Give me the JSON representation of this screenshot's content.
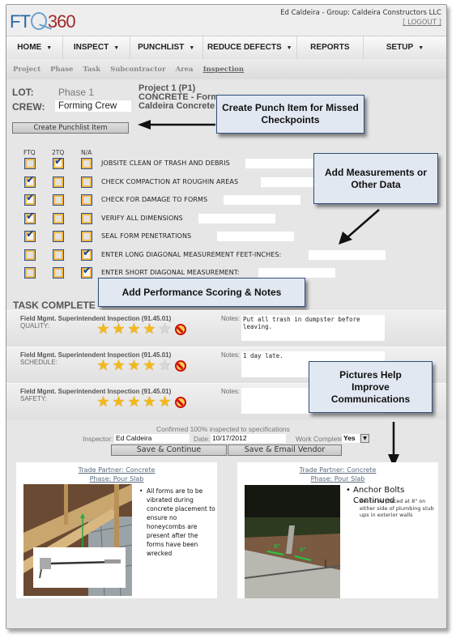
{
  "header": {
    "logo_left": "FT",
    "logo_right": "360",
    "user": "Ed Caldeira -  Group: Caldeira Constructors LLC",
    "logout": "[ LOGOUT ]"
  },
  "nav": {
    "items": [
      {
        "label": "HOME",
        "has_menu": true
      },
      {
        "label": "INSPECT",
        "has_menu": true
      },
      {
        "label": "PUNCHLIST",
        "has_menu": true
      },
      {
        "label": "REDUCE DEFECTS",
        "has_menu": true
      },
      {
        "label": "REPORTS",
        "has_menu": false
      },
      {
        "label": "SETUP",
        "has_menu": true
      }
    ]
  },
  "subnav": {
    "items": [
      "Project",
      "Phase",
      "Task",
      "Subcontractor",
      "Area",
      "Inspection"
    ],
    "active": "Inspection"
  },
  "info": {
    "lot_label": "LOT:",
    "lot_value": "Phase 1",
    "crew_label": "CREW:",
    "crew_value": "Forming Crew",
    "project_line1": "Project 1 (P1)",
    "project_line2": "CONCRETE - Forming",
    "project_line3": "Caldeira Concrete"
  },
  "create_punchlist_button": "Create Punchlist Item",
  "callouts": {
    "punch": "Create Punch Item for Missed Checkpoints",
    "measurements": "Add Measurements or Other Data",
    "scoring": "Add Performance Scoring & Notes",
    "pictures": "Pictures Help Improve Communications"
  },
  "checklist": {
    "columns": [
      "FTQ",
      "2TQ",
      "N/A"
    ],
    "items": [
      {
        "label": "JOBSITE CLEAN OF TRASH AND DEBRIS",
        "ftq": false,
        "twotq": true,
        "na": false,
        "value": ""
      },
      {
        "label": "CHECK COMPACTION AT ROUGHIN AREAS",
        "ftq": true,
        "twotq": false,
        "na": false,
        "value": ""
      },
      {
        "label": "CHECK FOR DAMAGE TO FORMS",
        "ftq": true,
        "twotq": false,
        "na": false,
        "value": ""
      },
      {
        "label": "VERIFY ALL DIMENSIONS",
        "ftq": true,
        "twotq": false,
        "na": false,
        "value": ""
      },
      {
        "label": "SEAL FORM PENETRATIONS",
        "ftq": true,
        "twotq": false,
        "na": false,
        "value": ""
      },
      {
        "label": "ENTER LONG DIAGONAL MEASUREMENT FEET-INCHES:",
        "ftq": false,
        "twotq": false,
        "na": true,
        "value": ""
      },
      {
        "label": "ENTER SHORT DIAGONAL MEASUREMENT:",
        "ftq": false,
        "twotq": false,
        "na": true,
        "value": ""
      }
    ]
  },
  "task_complete": {
    "title": "TASK COMPLETE",
    "scores": [
      {
        "title": "Field Mgmt. Superintendent Inspection (91.45.01)",
        "category": "QUALITY:",
        "stars": 4,
        "max_stars": 5,
        "notes_label": "Notes:",
        "notes": "Put all trash in dumpster before leaving."
      },
      {
        "title": "Field Mgmt. Superintendent Inspection (91.45.01)",
        "category": "SCHEDULE:",
        "stars": 4,
        "max_stars": 5,
        "notes_label": "Notes:",
        "notes": "1 day late."
      },
      {
        "title": "Field Mgmt. Superintendent Inspection (91.45.01)",
        "category": "SAFETY:",
        "stars": 5,
        "max_stars": 5,
        "notes_label": "Notes:",
        "notes": ""
      }
    ]
  },
  "footer": {
    "confirmed": "Confirmed 100% inspected to specifications",
    "inspector_label": "Inspector:",
    "inspector_value": "Ed Caldeira",
    "date_label": "Date:",
    "date_value": "10/17/2012",
    "work_complete_label": "Work Complete:",
    "work_complete_value": "Yes",
    "save_continue": "Save & Continue",
    "save_email": "Save & Email Vendor"
  },
  "slides": [
    {
      "title1": "Trade Partner: Concrete",
      "title2": "Phase: Pour Slab",
      "bullet": "All forms are to be vibrated during concrete placement to ensure no honeycombs are present after the forms have been wrecked",
      "sub_bullet": ""
    },
    {
      "title1": "Trade Partner: Concrete",
      "title2": "Phase: Pour Slab",
      "bullet": "Anchor Bolts Continued",
      "sub_bullet": "Are to be placed at 8\" on either side of plumbing stub ups in exterior walls",
      "photo_label": "8\""
    }
  ]
}
